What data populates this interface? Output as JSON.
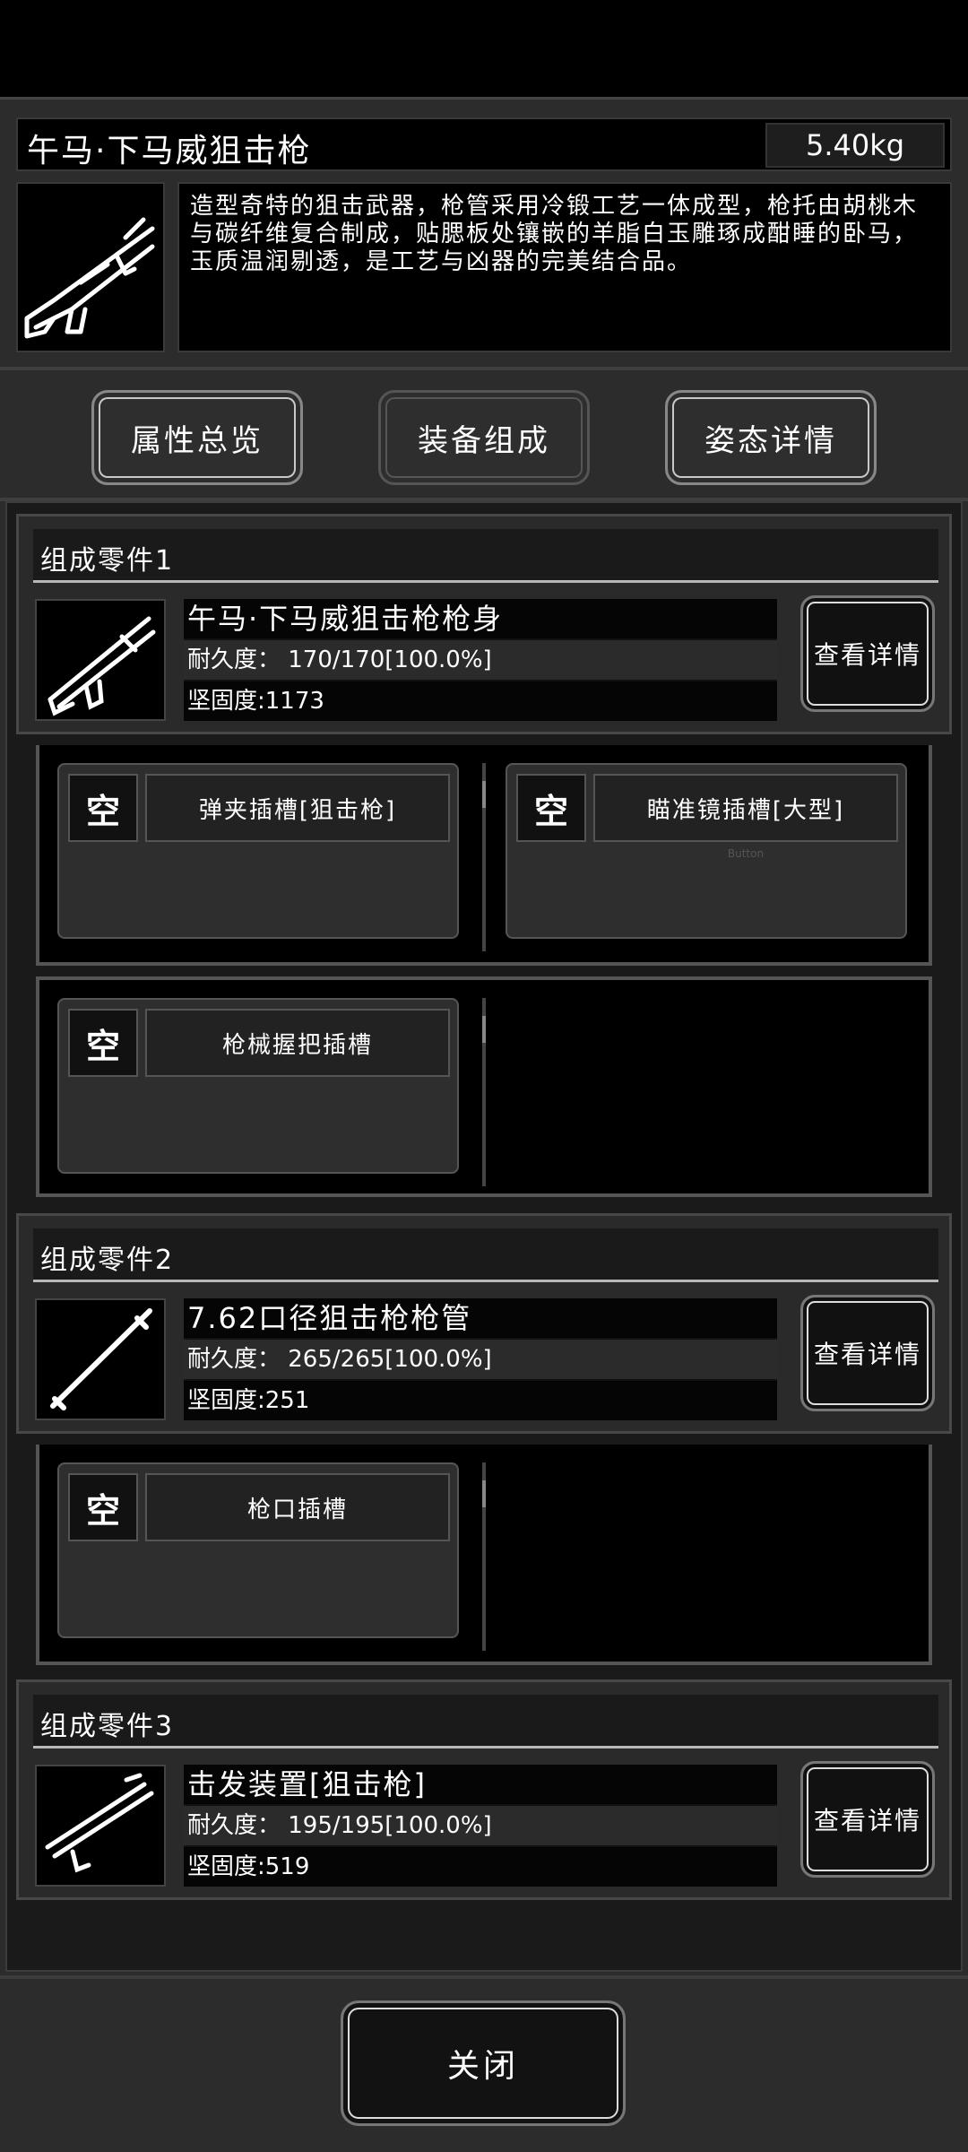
{
  "item": {
    "name": "午马·下马威狙击枪",
    "weight": "5.40kg",
    "thumb_icon": "sniper-rifle-icon",
    "description": "造型奇特的狙击武器，枪管采用冷锻工艺一体成型，枪托由胡桃木与碳纤维复合制成，贴腮板处镶嵌的羊脂白玉雕琢成酣睡的卧马，玉质温润剔透，是工艺与凶器的完美结合品。"
  },
  "tabs": [
    {
      "label": "属性总览",
      "active": false
    },
    {
      "label": "装备组成",
      "active": true
    },
    {
      "label": "姿态详情",
      "active": false
    }
  ],
  "components": [
    {
      "header": "组成零件1",
      "name": "午马·下马威狙击枪枪身",
      "durability": "耐久度： 170/170[100.0%]",
      "hardness": "坚固度:1173",
      "icon": "rifle-body-icon",
      "detail_label": "查看详情",
      "slots": [
        {
          "empty": "空",
          "name": "弹夹插槽[狙击枪]",
          "sub": ""
        },
        {
          "empty": "空",
          "name": "瞄准镜插槽[大型]",
          "sub": "Button"
        },
        {
          "empty": "空",
          "name": "枪械握把插槽",
          "sub": ""
        }
      ]
    },
    {
      "header": "组成零件2",
      "name": "7.62口径狙击枪枪管",
      "durability": "耐久度： 265/265[100.0%]",
      "hardness": "坚固度:251",
      "icon": "barrel-icon",
      "detail_label": "查看详情",
      "slots": [
        {
          "empty": "空",
          "name": "枪口插槽",
          "sub": ""
        }
      ]
    },
    {
      "header": "组成零件3",
      "name": "击发装置[狙击枪]",
      "durability": "耐久度： 195/195[100.0%]",
      "hardness": "坚固度:519",
      "icon": "firing-mechanism-icon",
      "detail_label": "查看详情",
      "slots": []
    }
  ],
  "close_label": "关闭"
}
